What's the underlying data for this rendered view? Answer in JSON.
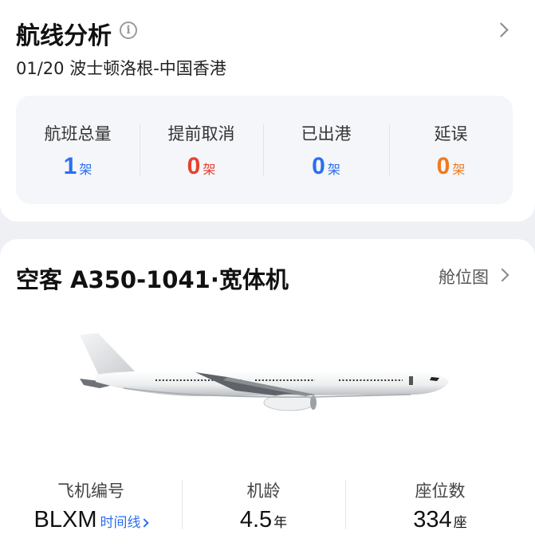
{
  "route": {
    "title": "航线分析",
    "info_icon": "i",
    "subtitle": "01/20 波士顿洛根-中国香港",
    "stats": [
      {
        "label": "航班总量",
        "value": "1",
        "unit": "架",
        "color": "#2b6ef0"
      },
      {
        "label": "提前取消",
        "value": "0",
        "unit": "架",
        "color": "#e8402f"
      },
      {
        "label": "已出港",
        "value": "0",
        "unit": "架",
        "color": "#2b6ef0"
      },
      {
        "label": "延误",
        "value": "0",
        "unit": "架",
        "color": "#f07a1c"
      }
    ]
  },
  "aircraft": {
    "title": "空客 A350-1041·宽体机",
    "seatmap_label": "舱位图",
    "specs": [
      {
        "label": "飞机编号",
        "value": "BLXM",
        "unit": "",
        "link": "时间线"
      },
      {
        "label": "机龄",
        "value": "4.5",
        "unit": "年",
        "link": ""
      },
      {
        "label": "座位数",
        "value": "334",
        "unit": "座",
        "link": ""
      }
    ]
  }
}
